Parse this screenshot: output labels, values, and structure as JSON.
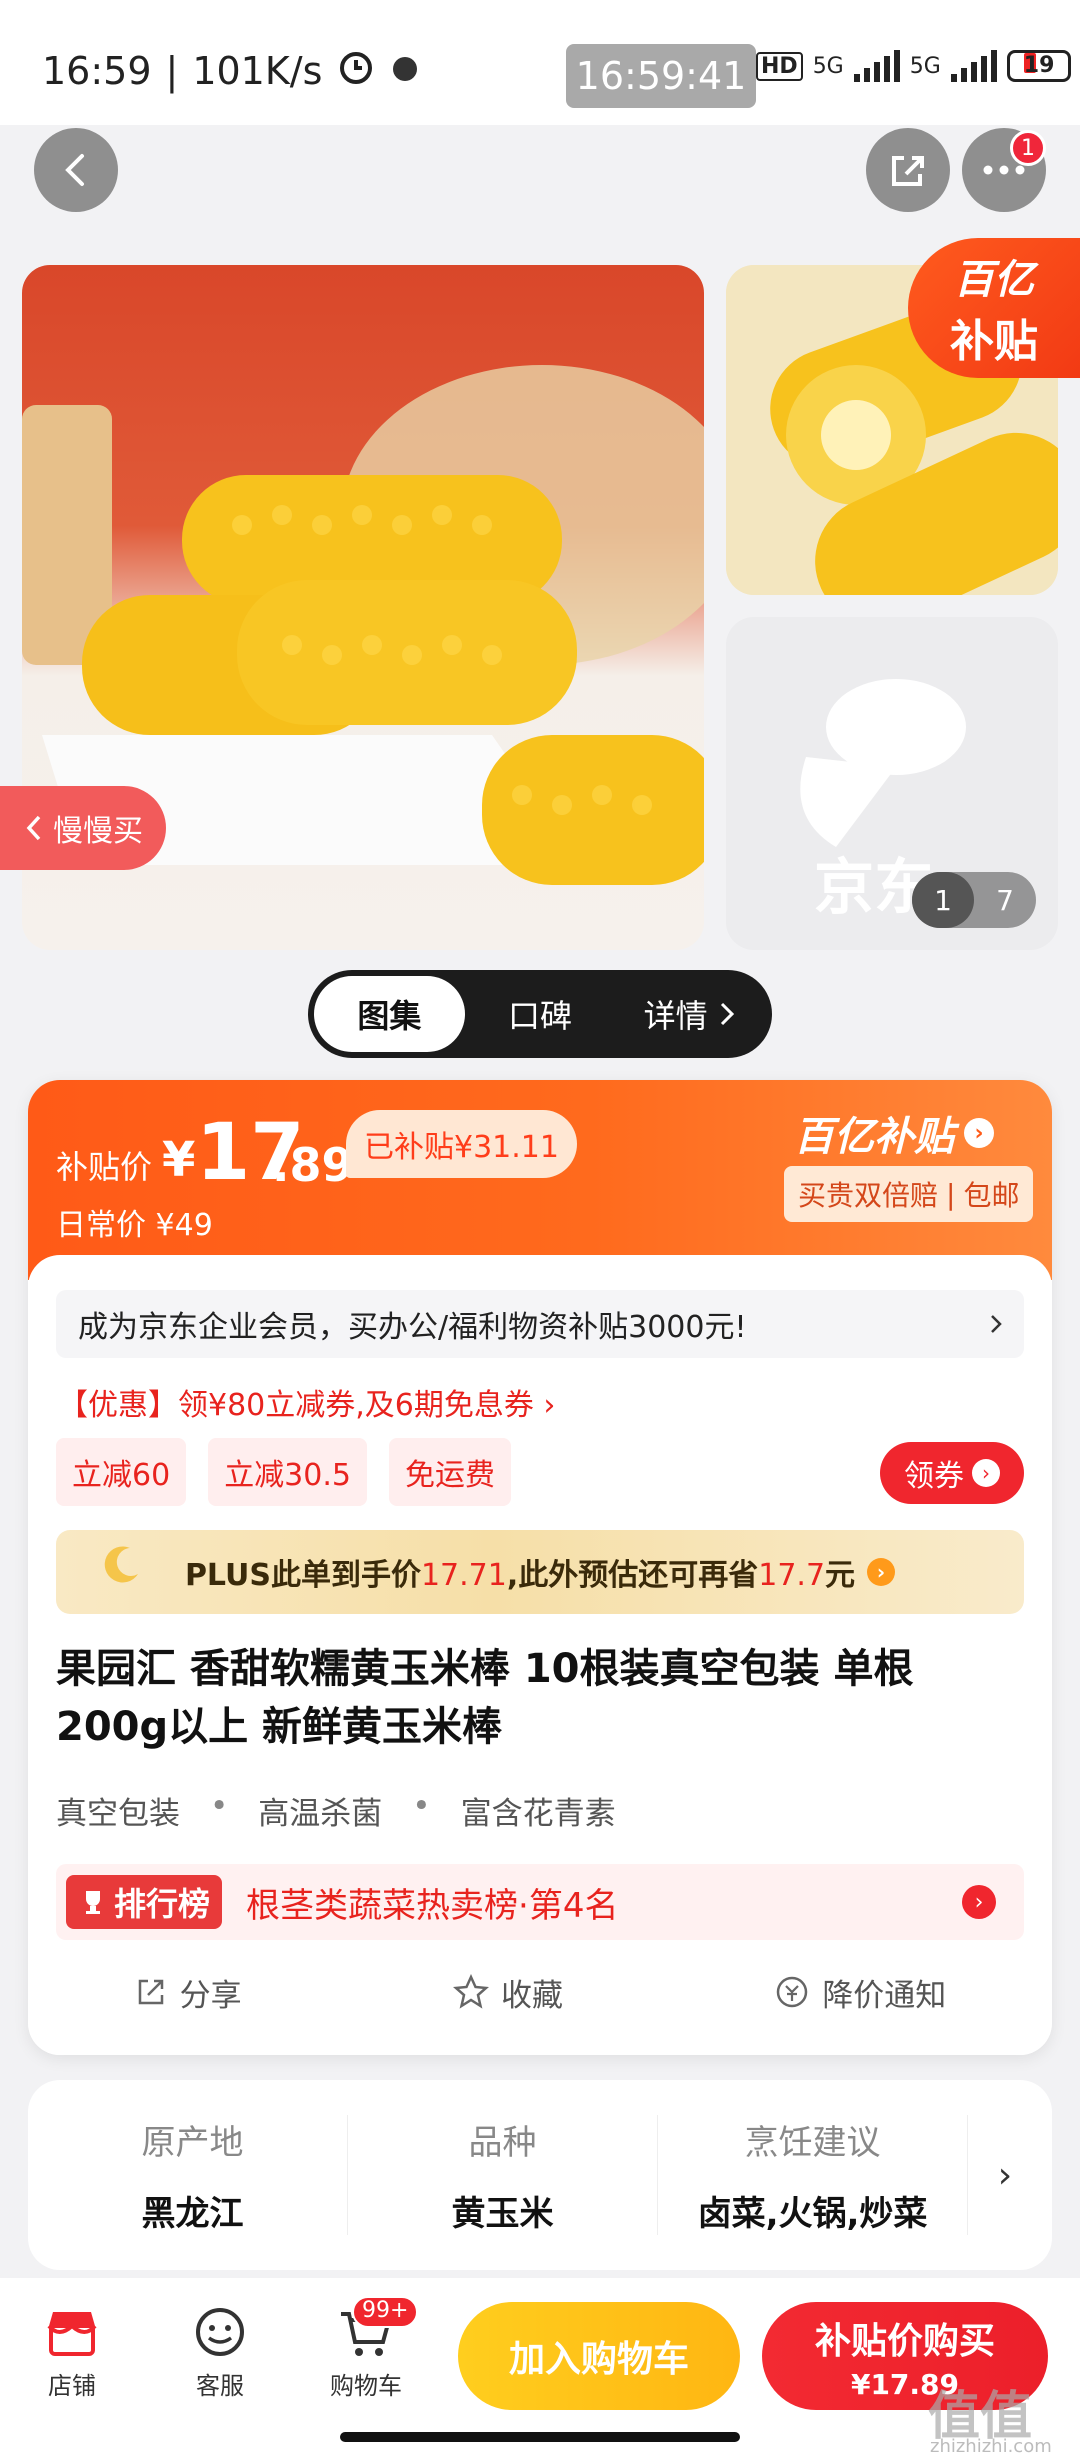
{
  "status_bar": {
    "time": "16:59",
    "speed": "101K/s",
    "clock_pill": "16:59:41",
    "hd": "HD",
    "net1": "5G",
    "net2": "5G",
    "battery": "19"
  },
  "nav": {
    "more_badge": "1"
  },
  "gallery": {
    "subsidy_line1": "百亿",
    "subsidy_line2": "补贴",
    "slow_buy": "慢慢买",
    "page_current": "1",
    "page_total": "7",
    "placeholder_logo": "京东",
    "tabs": [
      "图集",
      "口碑",
      "详情"
    ]
  },
  "price": {
    "label": "补贴价",
    "yen": "¥",
    "integer": "17",
    "decimal": ".89",
    "subsidized": "已补贴¥31.11",
    "daily": "日常价 ¥49",
    "brand": "百亿补贴",
    "guarantee": "买贵双倍赔",
    "guarantee_sep": "|",
    "free_ship": "包邮"
  },
  "promo": {
    "enterprise": "成为京东企业会员，买办公/福利物资补贴3000元!",
    "coupon_line": "【优惠】领¥80立减券,及6期免息券 ›",
    "chips": [
      "立减60",
      "立减30.5",
      "免运费"
    ],
    "coupon_button": "领券",
    "plus_prefix": "PLUS此单到手价",
    "plus_price": "17.71",
    "plus_mid": ",此外预估还可再省",
    "plus_save": "17.7",
    "plus_suffix": "元"
  },
  "product": {
    "title": "果园汇 香甜软糯黄玉米棒 10根装真空包装 单根200g以上 新鲜黄玉米棒",
    "features": [
      "真空包装",
      "高温杀菌",
      "富含花青素"
    ],
    "rank_badge": "排行榜",
    "rank_text": "根茎类蔬菜热卖榜·第4名"
  },
  "actions": [
    "分享",
    "收藏",
    "降价通知"
  ],
  "attributes": [
    {
      "key": "原产地",
      "value": "黑龙江"
    },
    {
      "key": "品种",
      "value": "黄玉米"
    },
    {
      "key": "烹饪建议",
      "value": "卤菜,火锅,炒菜"
    }
  ],
  "bottom_bar": {
    "store": "店铺",
    "service": "客服",
    "cart": "购物车",
    "cart_badge": "99+",
    "add_to_cart": "加入购物车",
    "buy_line1": "补贴价购买",
    "buy_line2": "¥17.89"
  },
  "watermark": {
    "main": "值值值",
    "sub": "zhizhizhi.com"
  },
  "colors": {
    "accent": "#f0262e",
    "orange": "#ff5a17",
    "yellow_button": "#ffc21a",
    "corn": "#f7c21d"
  }
}
